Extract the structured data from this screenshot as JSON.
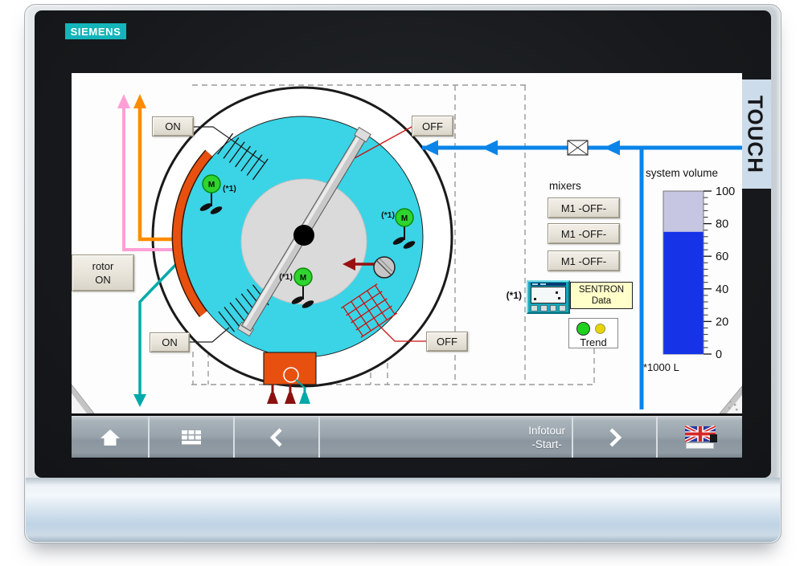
{
  "brand": {
    "logo": "SIEMENS",
    "touch_label": "TOUCH"
  },
  "schematic": {
    "buttons": {
      "rotor_line1": "rotor",
      "rotor_line2": "ON",
      "on_top": "ON",
      "off_top": "OFF",
      "on_bottom": "ON",
      "off_bottom": "OFF"
    },
    "motors": {
      "symbol": "M",
      "note": "(*1)"
    },
    "mixers": {
      "label": "mixers",
      "buttons": [
        "M1 -OFF-",
        "M1 -OFF-",
        "M1 -OFF-"
      ]
    },
    "sentron": {
      "note": "(*1)",
      "line1": "SENTRON",
      "line2": "Data"
    },
    "trend_label": "Trend",
    "gauge": {
      "title": "system volume",
      "unit": "*1000 L",
      "tick_labels": [
        "100",
        "80",
        "60",
        "40",
        "20",
        "0"
      ],
      "fill_percent": 75
    }
  },
  "navbar": {
    "infotour_line1": "Infotour",
    "infotour_line2": "-Start-"
  },
  "colors": {
    "water_cyan": "#3ad4e6",
    "pipe_blue": "#0a84e8",
    "alarm_orange": "#e8500f",
    "motor_green": "#2fd42f",
    "gauge_blue": "#1733e8",
    "siemens_teal": "#14b4b9"
  }
}
